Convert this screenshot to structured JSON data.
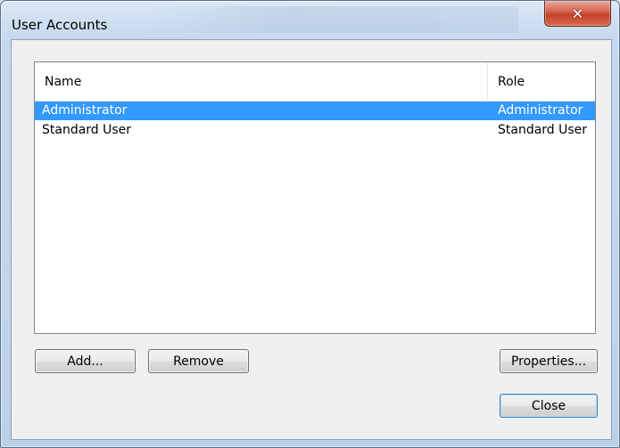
{
  "window": {
    "title": "User Accounts",
    "close_glyph": "✕"
  },
  "list": {
    "columns": {
      "name": "Name",
      "role": "Role"
    },
    "rows": [
      {
        "name": "Administrator",
        "role": "Administrator",
        "selected": true
      },
      {
        "name": "Standard User",
        "role": "Standard User",
        "selected": false
      }
    ]
  },
  "buttons": {
    "add": "Add...",
    "remove": "Remove",
    "properties": "Properties...",
    "close": "Close"
  },
  "colors": {
    "selection": "#3399ff",
    "close_button": "#c7412a"
  }
}
